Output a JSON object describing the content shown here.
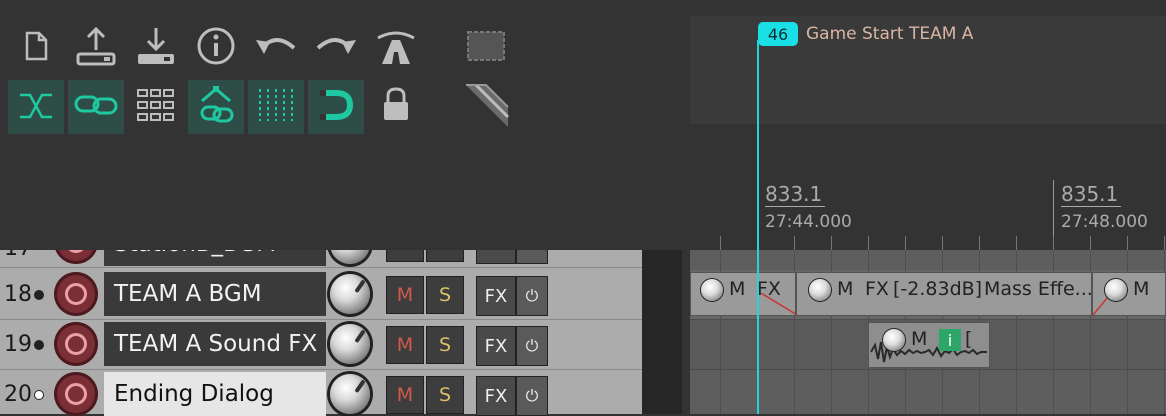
{
  "toolbar": {
    "row1": [
      {
        "icon": "new-project-icon",
        "glyph": "🗋"
      },
      {
        "icon": "upload-icon",
        "glyph": "⤒"
      },
      {
        "icon": "download-icon",
        "glyph": "⤓"
      },
      {
        "icon": "info-icon",
        "glyph": "ⓘ"
      },
      {
        "icon": "undo-icon",
        "glyph": "↶"
      },
      {
        "icon": "redo-icon",
        "glyph": "↷"
      },
      {
        "icon": "render-road-icon",
        "glyph": "⛙"
      },
      {
        "icon": "marquee-select-icon",
        "glyph": "⬚"
      }
    ],
    "row2": [
      {
        "icon": "crossfade-icon",
        "active": true
      },
      {
        "icon": "link-icon",
        "active": true
      },
      {
        "icon": "grid-icon",
        "active": false
      },
      {
        "icon": "grouping-icon",
        "active": true
      },
      {
        "icon": "snap-grid-icon",
        "active": true
      },
      {
        "icon": "magnet-icon",
        "active": true
      },
      {
        "icon": "lock-icon",
        "active": false
      },
      {
        "icon": "ruler-edit-icon",
        "active": false
      }
    ],
    "accent": "#1ec8a0"
  },
  "marker": {
    "number": "46",
    "label": "Game Start TEAM A",
    "color": "#19e0e6"
  },
  "ruler": {
    "marks": [
      {
        "bar": "833.1",
        "time": "27:44.000"
      },
      {
        "bar": "835.1",
        "time": "27:48.000"
      }
    ]
  },
  "tracks": [
    {
      "num": "17",
      "name": "StationB_BGM",
      "armed": false,
      "partial": true
    },
    {
      "num": "18",
      "name": "TEAM A BGM",
      "armed": false
    },
    {
      "num": "19",
      "name": "TEAM A Sound FX",
      "armed": false
    },
    {
      "num": "20",
      "name": "Ending Dialog",
      "armed": false,
      "selected": true
    }
  ],
  "track_buttons": {
    "mute": "M",
    "solo": "S",
    "fx": "FX",
    "power": "⏻"
  },
  "items": {
    "bgm_left": {
      "m": "M",
      "fx": "FX"
    },
    "bgm_main": {
      "m": "M",
      "fx": "FX",
      "gain": "[-2.83dB]",
      "name": "Mass Effe..."
    },
    "bgm_right": {
      "m": "M"
    },
    "sfx": {
      "m": "M",
      "info": "i",
      "bracket": "["
    }
  }
}
